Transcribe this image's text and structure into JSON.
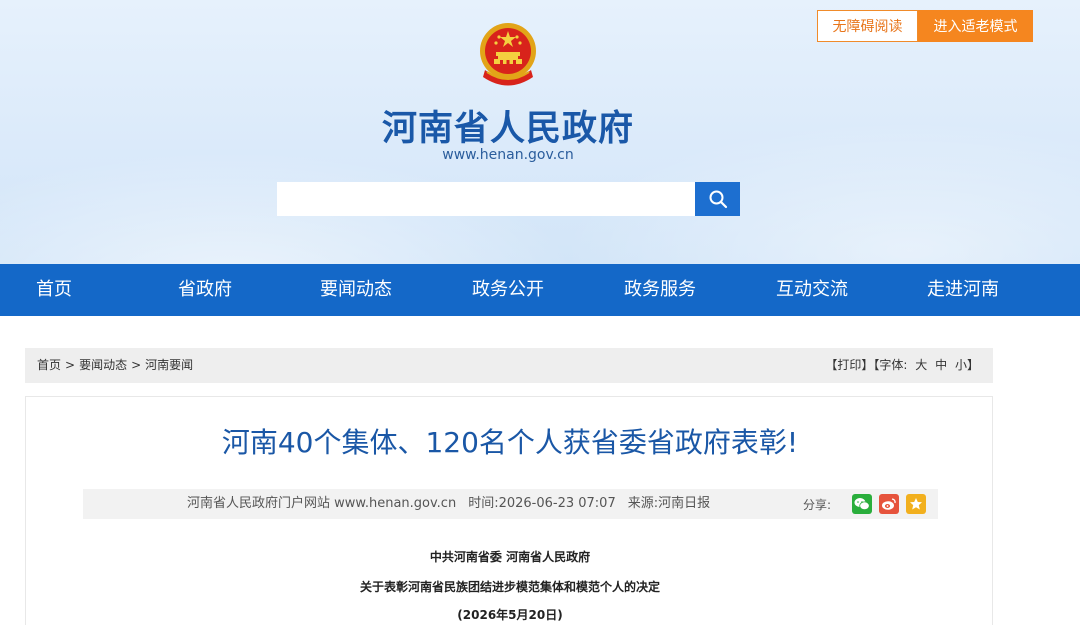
{
  "header": {
    "accessibility_label": "无障碍阅读",
    "elder_mode_label": "进入适老模式",
    "site_title": "河南省人民政府",
    "site_url": "www.henan.gov.cn",
    "search": {
      "placeholder": ""
    }
  },
  "nav": {
    "items": [
      {
        "label": "首页"
      },
      {
        "label": "省政府"
      },
      {
        "label": "要闻动态"
      },
      {
        "label": "政务公开"
      },
      {
        "label": "政务服务"
      },
      {
        "label": "互动交流"
      },
      {
        "label": "走进河南"
      }
    ]
  },
  "breadcrumb": {
    "items": [
      "首页",
      "要闻动态",
      "河南要闻"
    ],
    "separator": ">"
  },
  "tools": {
    "print": "【打印】",
    "font_label": "【字体:",
    "large": "大",
    "medium": "中",
    "small": "小",
    "close": "】"
  },
  "article": {
    "title": "河南40个集体、120名个人获省委省政府表彰!",
    "source_site": "河南省人民政府门户网站 www.henan.gov.cn",
    "time_label": "时间:2026-06-23 07:07",
    "origin_label": "来源:河南日报",
    "share_label": "分享:",
    "issuer": "中共河南省委 河南省人民政府",
    "decision_title": "关于表彰河南省民族团结进步模范集体和模范个人的决定",
    "date": "(2026年5月20日)"
  },
  "colors": {
    "brand_blue": "#1468c8",
    "title_blue": "#1a57a6",
    "accent_orange": "#f5861f",
    "wechat_green": "#2aae3c",
    "weibo_red": "#e6533c",
    "favorite_yellow": "#f2b01e"
  },
  "icons": {
    "emblem": "national-emblem-icon",
    "search": "search-icon",
    "wechat": "wechat-icon",
    "weibo": "weibo-icon",
    "favorite": "star-icon"
  }
}
